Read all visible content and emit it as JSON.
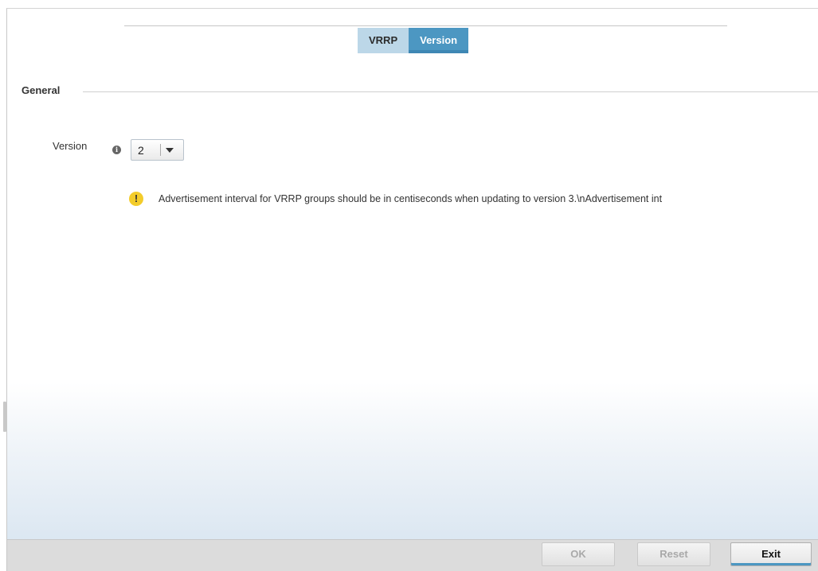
{
  "tabs": [
    {
      "label": "VRRP",
      "active": false
    },
    {
      "label": "Version",
      "active": true
    }
  ],
  "section": {
    "title": "General"
  },
  "version_field": {
    "label": "Version",
    "info_icon": "info-icon",
    "selected_value": "2"
  },
  "warning": {
    "icon": "warning-icon",
    "text": "Advertisement interval for VRRP groups should be in centiseconds when updating to version 3.\\nAdvertisement int"
  },
  "footer": {
    "ok_label": "OK",
    "reset_label": "Reset",
    "exit_label": "Exit"
  },
  "colors": {
    "tab_active": "#4c97c2",
    "tab_inactive": "#bcd7e8",
    "warning": "#f3cc2b"
  }
}
